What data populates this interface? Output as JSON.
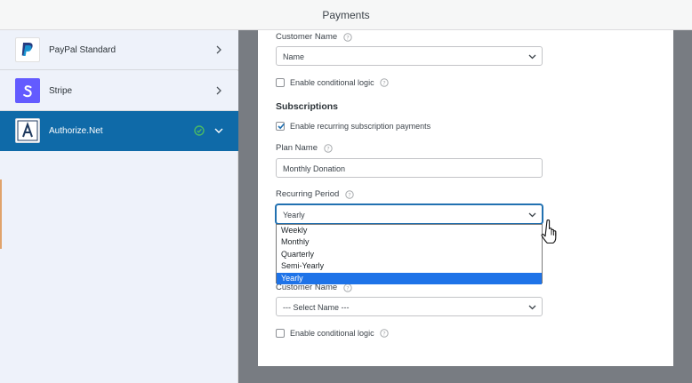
{
  "window": {
    "title": "Payments"
  },
  "sidebar": {
    "items": [
      {
        "label": "PayPal Standard",
        "icon": "paypal-logo",
        "color": "#253b80",
        "expanded": false
      },
      {
        "label": "Stripe",
        "icon": "stripe-logo",
        "color": "#635bff",
        "expanded": false
      },
      {
        "label": "Authorize.Net",
        "icon": "authorize-net-logo",
        "color": "#1f3a5f",
        "expanded": true,
        "enabled": true
      }
    ],
    "active_color": "#0f6aa8"
  },
  "form": {
    "customer_name_top": {
      "label": "Customer Name",
      "value": "Name"
    },
    "conditional_logic_top": {
      "label": "Enable conditional logic",
      "checked": false
    },
    "subscriptions": {
      "heading": "Subscriptions",
      "recurring": {
        "label": "Enable recurring subscription payments",
        "checked": true
      },
      "plan_name": {
        "label": "Plan Name",
        "value": "Monthly Donation"
      },
      "recurring_period": {
        "label": "Recurring Period",
        "value": "Yearly",
        "options": [
          "Weekly",
          "Monthly",
          "Quarterly",
          "Semi-Yearly",
          "Yearly"
        ],
        "highlighted": "Yearly"
      }
    },
    "customer_name_bottom": {
      "label": "Customer Name",
      "value": "--- Select Name ---"
    },
    "conditional_logic_bottom": {
      "label": "Enable conditional logic",
      "checked": false
    }
  },
  "colors": {
    "accent": "#2271b1",
    "highlight": "#1e73e8",
    "success": "#4ab866"
  }
}
